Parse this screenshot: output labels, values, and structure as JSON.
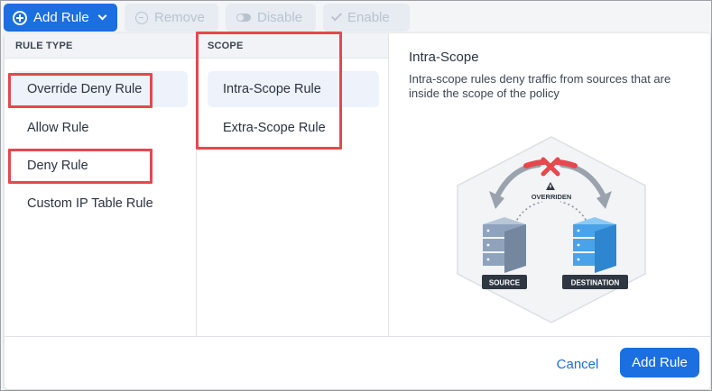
{
  "toolbar": {
    "add_rule": "Add Rule",
    "remove": "Remove",
    "disable": "Disable",
    "enable": "Enable"
  },
  "rule_type": {
    "header": "RULE TYPE",
    "items": [
      {
        "label": "Override Deny Rule",
        "selected": true
      },
      {
        "label": "Allow Rule",
        "selected": false
      },
      {
        "label": "Deny Rule",
        "selected": false
      },
      {
        "label": "Custom IP Table Rule",
        "selected": false
      }
    ]
  },
  "scope": {
    "header": "SCOPE",
    "items": [
      {
        "label": "Intra-Scope Rule",
        "selected": true
      },
      {
        "label": "Extra-Scope Rule",
        "selected": false
      }
    ]
  },
  "detail": {
    "title": "Intra-Scope",
    "description": "Intra-scope rules deny traffic from sources that are inside the scope of the policy",
    "illustration": {
      "overriden_label": "OVERRIDEN",
      "source_label": "SOURCE",
      "destination_label": "DESTINATION"
    }
  },
  "footer": {
    "cancel": "Cancel",
    "add_rule": "Add Rule"
  },
  "colors": {
    "primary": "#1b6fe0",
    "highlight": "#e5484d",
    "deny": "#e5484d",
    "source_server": "#8fa3bd",
    "destination_server": "#4aa3e8"
  }
}
